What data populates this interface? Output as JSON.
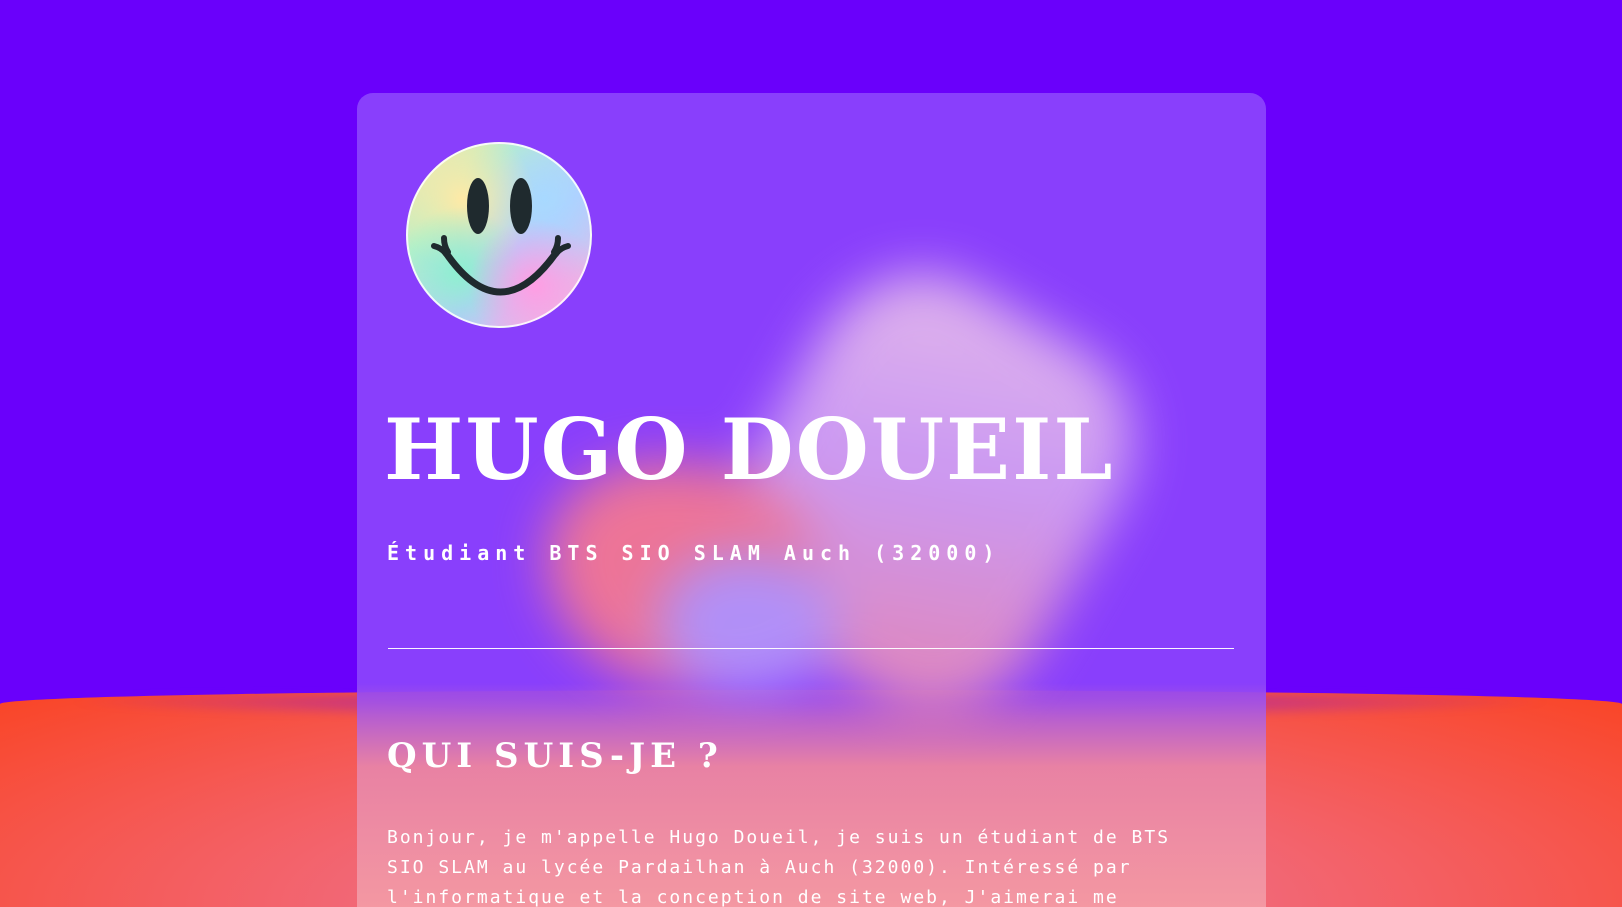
{
  "profile": {
    "avatar_icon": "smiley-face-icon",
    "name": "HUGO DOUEIL",
    "subtitle": "Étudiant BTS SIO SLAM Auch (32000)"
  },
  "about": {
    "title": "QUI SUIS-JE ?",
    "text": "Bonjour, je m'appelle Hugo Doueil, je suis un étudiant de BTS SIO SLAM au lycée Pardailhan à Auch (32000). Intéressé par l'informatique et la conception de site web, J'aimerai me spécialiser dans ce domaine et en"
  },
  "colors": {
    "background": "#6a00fb",
    "card": "#8c44fc",
    "floor": "#fa4424",
    "text": "#ffffff"
  }
}
